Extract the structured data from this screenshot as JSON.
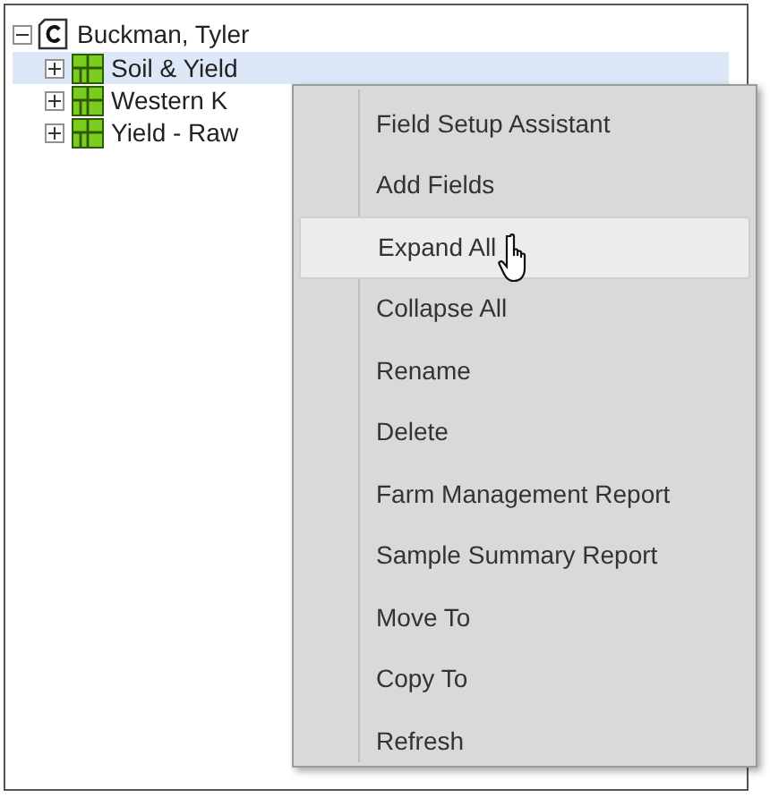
{
  "tree": {
    "label": "Buckman, Tyler",
    "expanded": true,
    "children": [
      {
        "label": "Soil & Yield",
        "expanded": false,
        "selected": true
      },
      {
        "label": "Western K",
        "expanded": false,
        "selected": false
      },
      {
        "label": "Yield - Raw",
        "expanded": false,
        "selected": false
      }
    ]
  },
  "context_menu": {
    "items": [
      {
        "label": "Field Setup Assistant",
        "selected": false
      },
      {
        "label": "Add Fields",
        "selected": false
      },
      {
        "label": "Expand All",
        "selected": true
      },
      {
        "label": "Collapse All",
        "selected": false
      },
      {
        "label": "Rename",
        "selected": false
      },
      {
        "label": "Delete",
        "selected": false
      },
      {
        "label": "Farm Management Report",
        "selected": false
      },
      {
        "label": "Sample Summary Report",
        "selected": false
      },
      {
        "label": "Move To",
        "selected": false
      },
      {
        "label": "Copy To",
        "selected": false
      },
      {
        "label": "Refresh",
        "selected": false
      }
    ]
  }
}
